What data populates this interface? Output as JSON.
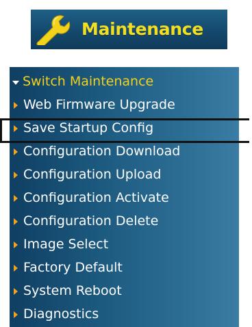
{
  "header": {
    "title": "Maintenance",
    "icon": "wrench-icon",
    "colors": {
      "badge_bg": "#14496d",
      "title": "#f3df1f",
      "wrench": "#f3d21b"
    }
  },
  "menu": {
    "section_label": "Switch Maintenance",
    "items": [
      {
        "label": "Web Firmware Upgrade"
      },
      {
        "label": "Save Startup Config",
        "highlighted": true
      },
      {
        "label": "Configuration Download"
      },
      {
        "label": "Configuration Upload"
      },
      {
        "label": "Configuration Activate"
      },
      {
        "label": "Configuration Delete"
      },
      {
        "label": "Image Select"
      },
      {
        "label": "Factory Default"
      },
      {
        "label": "System Reboot"
      },
      {
        "label": "Diagnostics"
      }
    ],
    "colors": {
      "panel_bg": "#1d5a80",
      "section_label": "#f2d21b",
      "arrow": "#f2a21b",
      "item_text": "#ffffff"
    }
  }
}
